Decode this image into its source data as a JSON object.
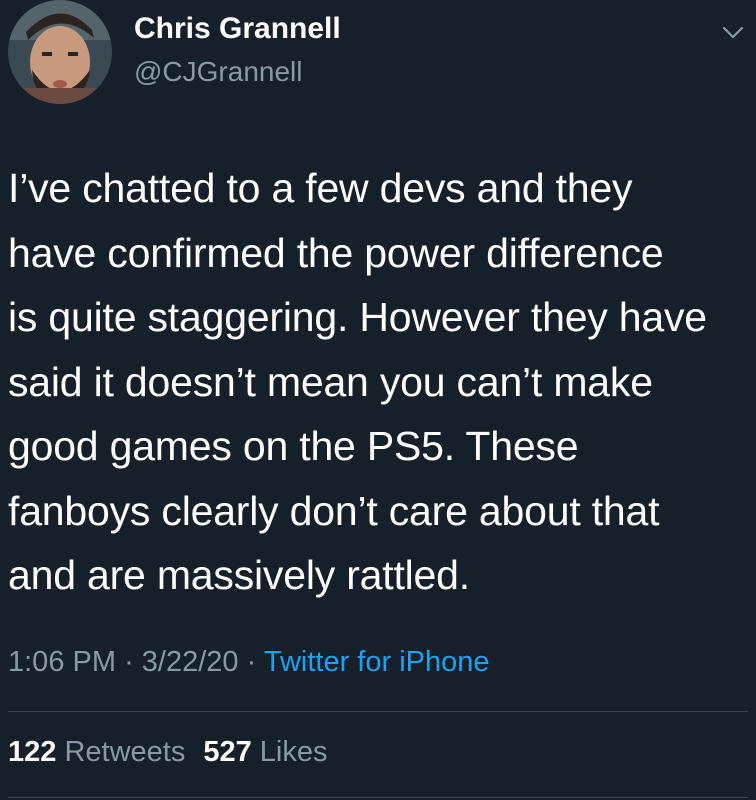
{
  "author": {
    "display_name": "Chris Grannell",
    "handle": "@CJGrannell",
    "avatar_icon": "profile-photo"
  },
  "menu_icon": "chevron-down-icon",
  "tweet": {
    "lines": [
      "I’ve chatted to a few devs and they",
      "have confirmed the power difference",
      "is quite staggering. However they have",
      "said it doesn’t mean you can’t make",
      "good games on the PS5. These",
      "fanboys clearly don’t care about that",
      "and are massively rattled."
    ]
  },
  "meta": {
    "time": "1:06 PM",
    "separator": "·",
    "date": "3/22/20",
    "source": "Twitter for iPhone"
  },
  "stats": {
    "retweets_count": "122",
    "retweets_label": "Retweets",
    "likes_count": "527",
    "likes_label": "Likes"
  },
  "colors": {
    "background": "#15202b",
    "primary_text": "#ffffff",
    "secondary_text": "#8899a6",
    "link": "#1da1f2",
    "divider": "#38444d"
  }
}
